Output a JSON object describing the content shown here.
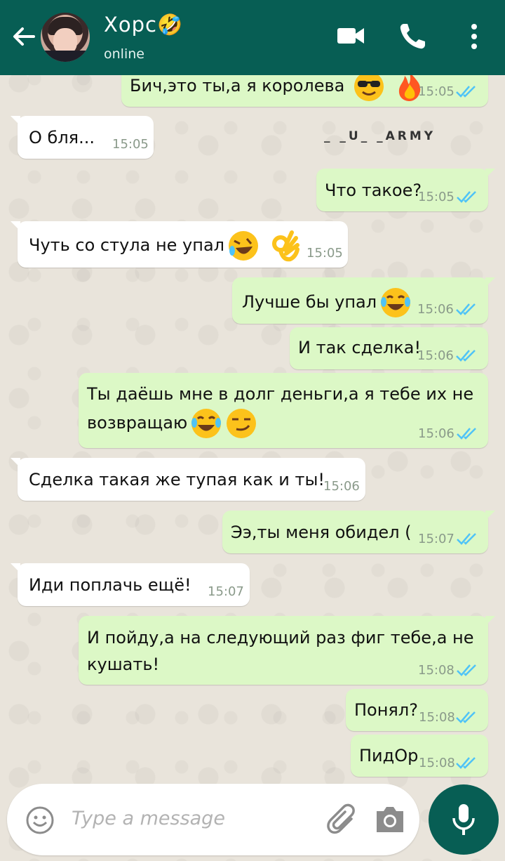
{
  "header": {
    "name": "Хорс🤣",
    "status": "online",
    "icons": [
      "back-arrow-icon",
      "video-call-icon",
      "phone-icon",
      "menu-dots-icon"
    ]
  },
  "watermark": "_ _U_ _ARMY",
  "messages": [
    {
      "dir": "out",
      "text": "Бич,это ты,а я королева",
      "time": "15:05",
      "emoji": [
        "sunglasses-emoji",
        "fire-emoji"
      ]
    },
    {
      "dir": "in",
      "text": "О бля...",
      "time": "15:05"
    },
    {
      "dir": "out",
      "text": "Что такое?",
      "time": "15:05"
    },
    {
      "dir": "in",
      "text": "Чуть со стула не упал",
      "time": "15:05",
      "emoji": [
        "rofl-emoji",
        "ok-hand-emoji"
      ]
    },
    {
      "dir": "out",
      "text": "Лучше бы упал",
      "time": "15:06",
      "emoji": [
        "joy-emoji"
      ]
    },
    {
      "dir": "out",
      "text": "И так сделка!",
      "time": "15:06"
    },
    {
      "dir": "out",
      "text": "Ты даёшь мне в долг деньги,а я тебе их не возвращаю",
      "time": "15:06",
      "emoji": [
        "joy-emoji",
        "smirk-emoji"
      ]
    },
    {
      "dir": "in",
      "text": "Сделка такая же тупая как и ты!",
      "time": "15:06"
    },
    {
      "dir": "out",
      "text": "Ээ,ты меня обидел (",
      "time": "15:07"
    },
    {
      "dir": "in",
      "text": "Иди поплачь ещё!",
      "time": "15:07"
    },
    {
      "dir": "out",
      "text": "И пойду,а на следующий раз фиг тебе,а не кушать!",
      "time": "15:08"
    },
    {
      "dir": "out",
      "text": "Понял?",
      "time": "15:08"
    },
    {
      "dir": "out",
      "text": "ПидОр",
      "time": "15:08"
    }
  ],
  "input": {
    "placeholder": "Type a message",
    "icons": [
      "emoji-icon",
      "attach-icon",
      "camera-icon",
      "mic-icon"
    ]
  },
  "colors": {
    "header": "#075e54",
    "outgoing": "#dcf8c6",
    "incoming": "#ffffff",
    "ticks": "#4fc3f7"
  }
}
